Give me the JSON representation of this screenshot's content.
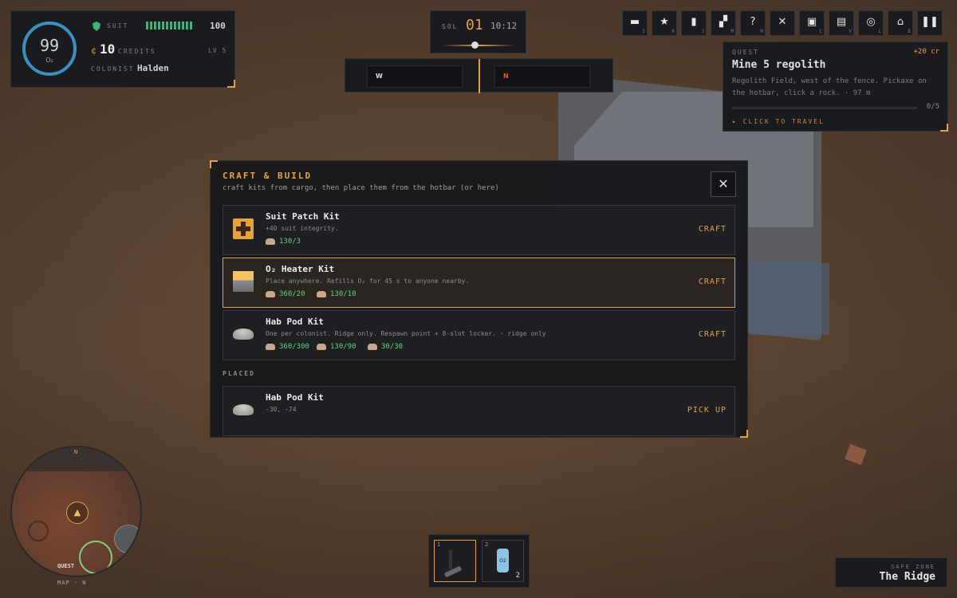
{
  "status": {
    "o2_value": "99",
    "o2_label": "O₂",
    "suit_label": "SUIT",
    "suit_value": "100",
    "suit_fraction": 1.0,
    "credit_symbol": "¢",
    "credits_value": "10",
    "credits_label": "CREDITS",
    "level": "LV 5",
    "colonist_label": "COLONIST",
    "colonist_name": "Halden"
  },
  "clock": {
    "sol_label": "SOL",
    "sol_number": "01",
    "time": "10:12"
  },
  "compass": {
    "left": "W",
    "right": "N"
  },
  "toolbar": [
    {
      "icon": "briefcase-icon",
      "glyph": "▬",
      "key": "I"
    },
    {
      "icon": "star-icon",
      "glyph": "★",
      "key": "K"
    },
    {
      "icon": "journal-icon",
      "glyph": "▮",
      "key": "J"
    },
    {
      "icon": "map-icon",
      "glyph": "▞",
      "key": "M"
    },
    {
      "icon": "help-icon",
      "glyph": "?",
      "key": "H"
    },
    {
      "icon": "mute-icon",
      "glyph": "✕",
      "key": ""
    },
    {
      "icon": "backpack-icon",
      "glyph": "▣",
      "key": "C"
    },
    {
      "icon": "storage-icon",
      "glyph": "▤",
      "key": "V"
    },
    {
      "icon": "settings-icon",
      "glyph": "◎",
      "key": "L"
    },
    {
      "icon": "home-icon",
      "glyph": "⌂",
      "key": "B"
    },
    {
      "icon": "pause-icon",
      "glyph": "❚❚",
      "key": ""
    }
  ],
  "quest": {
    "label": "QUEST",
    "reward": "+20 cr",
    "title": "Mine 5 regolith",
    "description": "Regolith Field, west of the fence. Pickaxe on the hotbar, click a rock. · 97 m",
    "progress_text": "0/5",
    "progress_fraction": 0,
    "travel": "▸ CLICK TO TRAVEL"
  },
  "craft": {
    "title": "CRAFT & BUILD",
    "subtitle": "craft kits from cargo, then place them from the hotbar (or here)",
    "close": "✕",
    "recipes": [
      {
        "name": "Suit Patch Kit",
        "desc": "+40 suit integrity.",
        "icon": "medkit-icon",
        "costs": [
          "130/3"
        ],
        "action": "CRAFT"
      },
      {
        "name": "O₂ Heater Kit",
        "desc": "Place anywhere. Refills O₂ for 45 s to anyone nearby.",
        "icon": "heater-icon",
        "costs": [
          "360/20",
          "130/10"
        ],
        "action": "CRAFT"
      },
      {
        "name": "Hab Pod Kit",
        "desc": "One per colonist. Ridge only. Respawn point + 8-slot locker. · ridge only",
        "icon": "hab-pod-icon",
        "costs": [
          "360/300",
          "130/90",
          "30/30"
        ],
        "action": "CRAFT"
      }
    ],
    "placed_label": "PLACED",
    "placed": [
      {
        "name": "Hab Pod Kit",
        "desc": "-30, -74",
        "icon": "hab-pod-icon",
        "action": "PICK UP"
      }
    ]
  },
  "minimap": {
    "north": "N",
    "quest_marker": "QUEST",
    "label": "MAP · N"
  },
  "hotbar": [
    {
      "num": "1",
      "item": "pickaxe-icon",
      "count": ""
    },
    {
      "num": "2",
      "item": "o2-bottle-icon",
      "label": "O2",
      "count": "2"
    }
  ],
  "zone": {
    "label": "SAFE ZONE",
    "name": "The Ridge"
  },
  "colors": {
    "accent": "#e0a24a",
    "suit_green": "#3fb37a",
    "cost_green": "#5fd38a",
    "o2_ring": "#3a90c0"
  }
}
